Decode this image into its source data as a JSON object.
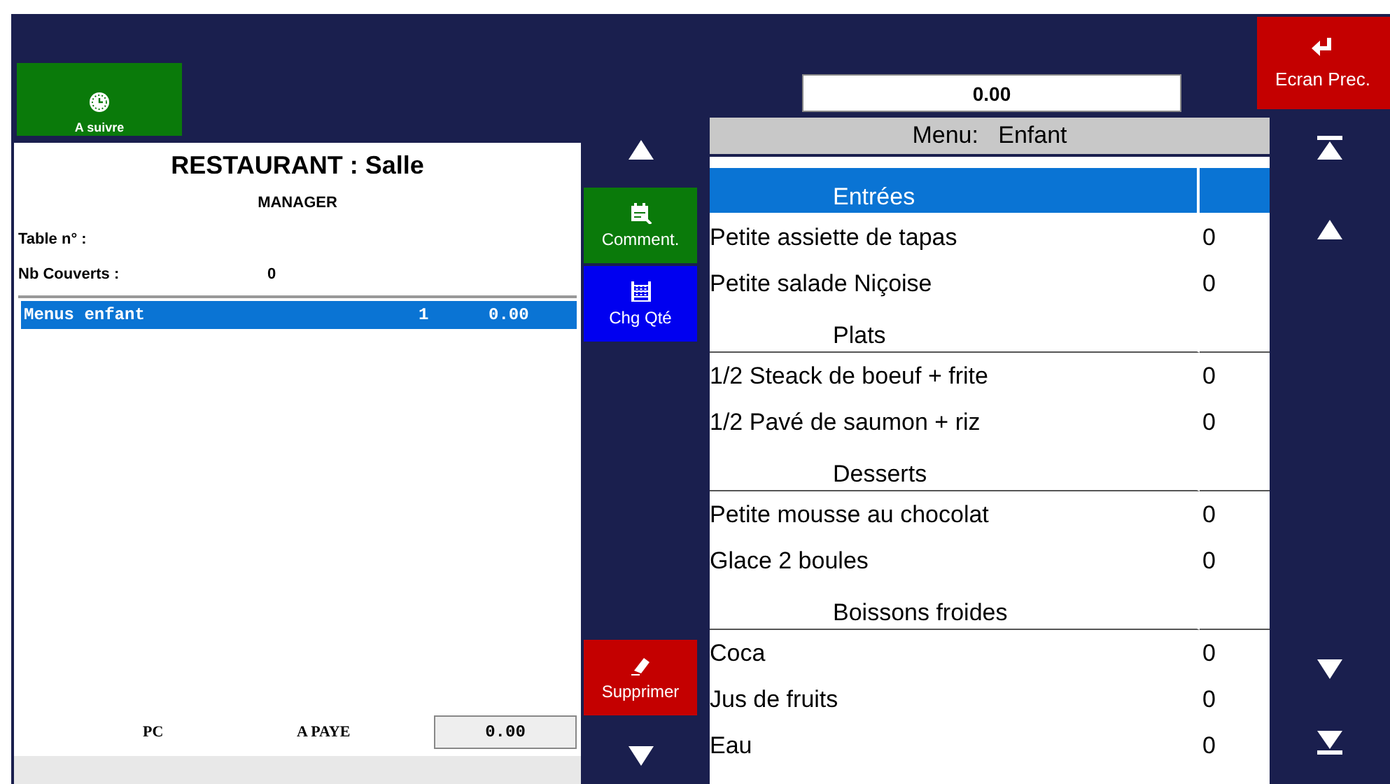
{
  "follow_button": {
    "label": "A suivre"
  },
  "ticket": {
    "title": "RESTAURANT : Salle",
    "user": "MANAGER",
    "fields": [
      {
        "label": "Table n° :"
      },
      {
        "label": "Nb Couverts :",
        "value": "0"
      }
    ],
    "lines": [
      {
        "name": "Menus enfant",
        "qty": "1",
        "price": "0.00",
        "selected": true
      }
    ],
    "footer": {
      "label_1": "PC",
      "label_2": "A PAYE",
      "total": "0.00"
    }
  },
  "actions": [
    {
      "kind": "comment",
      "label": "Comment."
    },
    {
      "kind": "quantity",
      "label": "Chg Qté"
    },
    {
      "kind": "delete",
      "label": "Supprimer"
    }
  ],
  "total_field": {
    "value": "0.00"
  },
  "back_button": {
    "label": "Ecran Prec."
  },
  "menu": {
    "title": "Menu:   Enfant",
    "rows": [
      {
        "kind": "category",
        "name": "Entrées",
        "selected": true
      },
      {
        "kind": "item",
        "name": "Petite assiette de tapas",
        "qty": "0",
        "selected": false
      },
      {
        "kind": "item",
        "name": "Petite salade Niçoise",
        "qty": "0",
        "selected": false
      },
      {
        "kind": "category",
        "name": "Plats",
        "selected": false
      },
      {
        "kind": "item",
        "name": "1/2 Steack de boeuf + frite",
        "qty": "0",
        "selected": false
      },
      {
        "kind": "item",
        "name": "1/2 Pavé de saumon + riz",
        "qty": "0",
        "selected": false
      },
      {
        "kind": "category",
        "name": "Desserts",
        "selected": false
      },
      {
        "kind": "item",
        "name": "Petite mousse au chocolat",
        "qty": "0",
        "selected": false
      },
      {
        "kind": "item",
        "name": "Glace 2 boules",
        "qty": "0",
        "selected": false
      },
      {
        "kind": "category",
        "name": "Boissons froides",
        "selected": false
      },
      {
        "kind": "item",
        "name": "Coca",
        "qty": "0",
        "selected": false
      },
      {
        "kind": "item",
        "name": "Jus de fruits",
        "qty": "0",
        "selected": false
      },
      {
        "kind": "item",
        "name": "Eau",
        "qty": "0",
        "selected": false
      }
    ]
  }
}
